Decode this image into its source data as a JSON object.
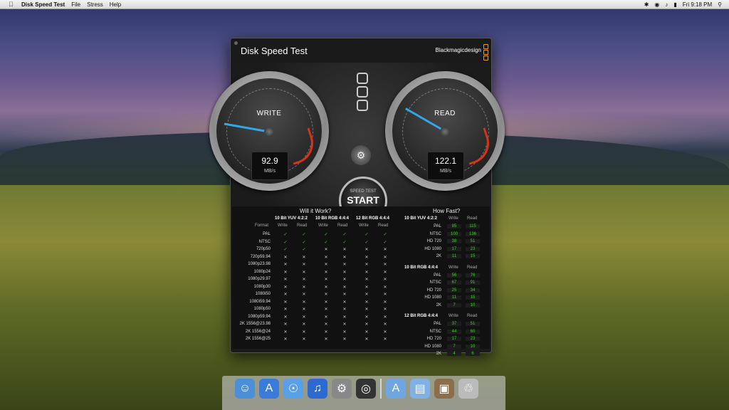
{
  "menubar": {
    "app": "Disk Speed Test",
    "items": [
      "File",
      "Stress",
      "Help"
    ],
    "clock": "Fri 9:18 PM"
  },
  "window": {
    "title": "Disk Speed Test",
    "brand": "Blackmagicdesign",
    "write": {
      "label": "WRITE",
      "value": "92.9",
      "unit": "MB/s"
    },
    "read": {
      "label": "READ",
      "value": "122.1",
      "unit": "MB/s"
    },
    "start": {
      "small": "SPEED TEST",
      "big": "START"
    },
    "will_header": "Will it Work?",
    "fast_header": "How Fast?",
    "groups": [
      "10 Bit YUV 4:2:2",
      "10 Bit RGB 4:4:4",
      "12 Bit RGB 4:4:4"
    ],
    "sub": {
      "format": "Format",
      "write": "Write",
      "read": "Read"
    },
    "rows": [
      {
        "f": "PAL",
        "c": [
          1,
          1,
          1,
          1,
          1,
          1
        ]
      },
      {
        "f": "NTSC",
        "c": [
          1,
          1,
          1,
          1,
          1,
          1
        ]
      },
      {
        "f": "720p50",
        "c": [
          1,
          1,
          0,
          0,
          0,
          0
        ]
      },
      {
        "f": "720p59.94",
        "c": [
          0,
          0,
          0,
          0,
          0,
          0
        ]
      },
      {
        "f": "1080p23.98",
        "c": [
          0,
          0,
          0,
          0,
          0,
          0
        ]
      },
      {
        "f": "1080p24",
        "c": [
          0,
          0,
          0,
          0,
          0,
          0
        ]
      },
      {
        "f": "1080p29.97",
        "c": [
          0,
          0,
          0,
          0,
          0,
          0
        ]
      },
      {
        "f": "1080p30",
        "c": [
          0,
          0,
          0,
          0,
          0,
          0
        ]
      },
      {
        "f": "1080i50",
        "c": [
          0,
          0,
          0,
          0,
          0,
          0
        ]
      },
      {
        "f": "1080i59.94",
        "c": [
          0,
          0,
          0,
          0,
          0,
          0
        ]
      },
      {
        "f": "1080p50",
        "c": [
          0,
          0,
          0,
          0,
          0,
          0
        ]
      },
      {
        "f": "1080p59.94",
        "c": [
          0,
          0,
          0,
          0,
          0,
          0
        ]
      },
      {
        "f": "2K 1556@23.98",
        "c": [
          0,
          0,
          0,
          0,
          0,
          0
        ]
      },
      {
        "f": "2K 1556@24",
        "c": [
          0,
          0,
          0,
          0,
          0,
          0
        ]
      },
      {
        "f": "2K 1556@25",
        "c": [
          0,
          0,
          0,
          0,
          0,
          0
        ]
      }
    ],
    "fast": [
      {
        "name": "10 Bit YUV 4:2:2",
        "rows": [
          [
            "PAL",
            "85",
            "115"
          ],
          [
            "NTSC",
            "100",
            "136"
          ],
          [
            "HD 720",
            "38",
            "51"
          ],
          [
            "HD 1080",
            "17",
            "23"
          ],
          [
            "2K",
            "11",
            "15"
          ]
        ]
      },
      {
        "name": "10 Bit RGB 4:4:4",
        "rows": [
          [
            "PAL",
            "56",
            "76"
          ],
          [
            "NTSC",
            "67",
            "91"
          ],
          [
            "HD 720",
            "25",
            "34"
          ],
          [
            "HD 1080",
            "11",
            "15"
          ],
          [
            "2K",
            "7",
            "10"
          ]
        ]
      },
      {
        "name": "12 Bit RGB 4:4:4",
        "rows": [
          [
            "PAL",
            "37",
            "51"
          ],
          [
            "NTSC",
            "44",
            "60"
          ],
          [
            "HD 720",
            "17",
            "23"
          ],
          [
            "HD 1080",
            "7",
            "10"
          ],
          [
            "2K",
            "4",
            "6"
          ]
        ]
      }
    ]
  },
  "dock": [
    "finder-icon",
    "app-store-icon",
    "safari-icon",
    "itunes-icon",
    "system-preferences-icon",
    "disk-speed-test-icon",
    "applications-folder-icon",
    "documents-folder-icon",
    "preview-icon",
    "trash-icon"
  ]
}
